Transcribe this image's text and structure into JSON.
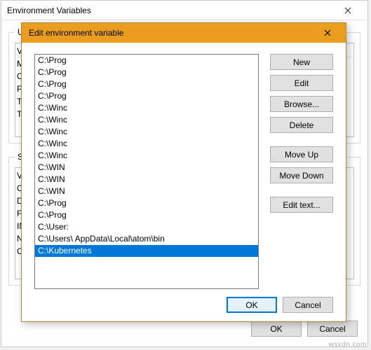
{
  "back": {
    "title": "Environment Variables",
    "user_legend": "User",
    "sys_legend": "Syst",
    "header_col1": "Va",
    "user_rows": [
      "M",
      "O",
      "Pa",
      "TE",
      "TM"
    ],
    "sys_rows": [
      "Va",
      "Co",
      "Dr",
      "FP",
      "IN",
      "NU",
      "O"
    ],
    "ok": "OK",
    "cancel": "Cancel"
  },
  "modal": {
    "title": "Edit environment variable",
    "items": [
      "C:\\Prog",
      "C:\\Prog",
      "C:\\Prog",
      "C:\\Prog",
      "C:\\Winc",
      "C:\\Winc",
      "C:\\Winc",
      "C:\\Winc",
      "C:\\Winc",
      "C:\\WIN",
      "C:\\WIN",
      "C:\\WIN",
      "C:\\Prog",
      "C:\\Prog",
      "C:\\User:",
      "C:\\Users\\             AppData\\Local\\atom\\bin",
      "C:\\Kubernetes"
    ],
    "selected_index": 16,
    "buttons": {
      "new": "New",
      "edit": "Edit",
      "browse": "Browse...",
      "delete": "Delete",
      "moveup": "Move Up",
      "movedown": "Move Down",
      "edittext": "Edit text...",
      "ok": "OK",
      "cancel": "Cancel"
    }
  },
  "watermark": "wsxdn.com"
}
